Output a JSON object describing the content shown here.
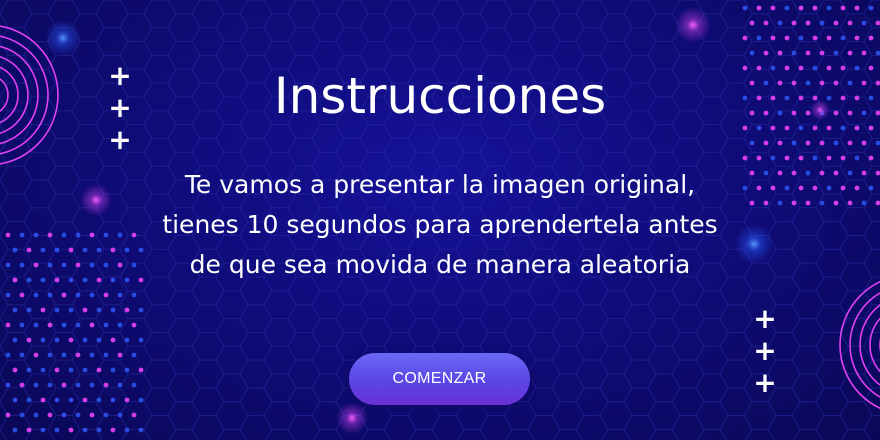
{
  "screen": {
    "title": "Instrucciones",
    "description": "Te vamos a presentar la imagen original, tienes 10 segundos para aprendertela antes de que sea movida de manera aleatoria",
    "start_button_label": "COMENZAR"
  },
  "decor": {
    "plus_glyph": "+",
    "icons": [
      "plus-icon",
      "concentric-rings",
      "dot-grid",
      "glow-spot",
      "hexagon-pattern"
    ]
  },
  "colors": {
    "background": "#0f0c7a",
    "accent_magenta": "#e040f0",
    "accent_blue": "#2f5bff",
    "button": "#5a46e4",
    "text": "#ffffff"
  }
}
